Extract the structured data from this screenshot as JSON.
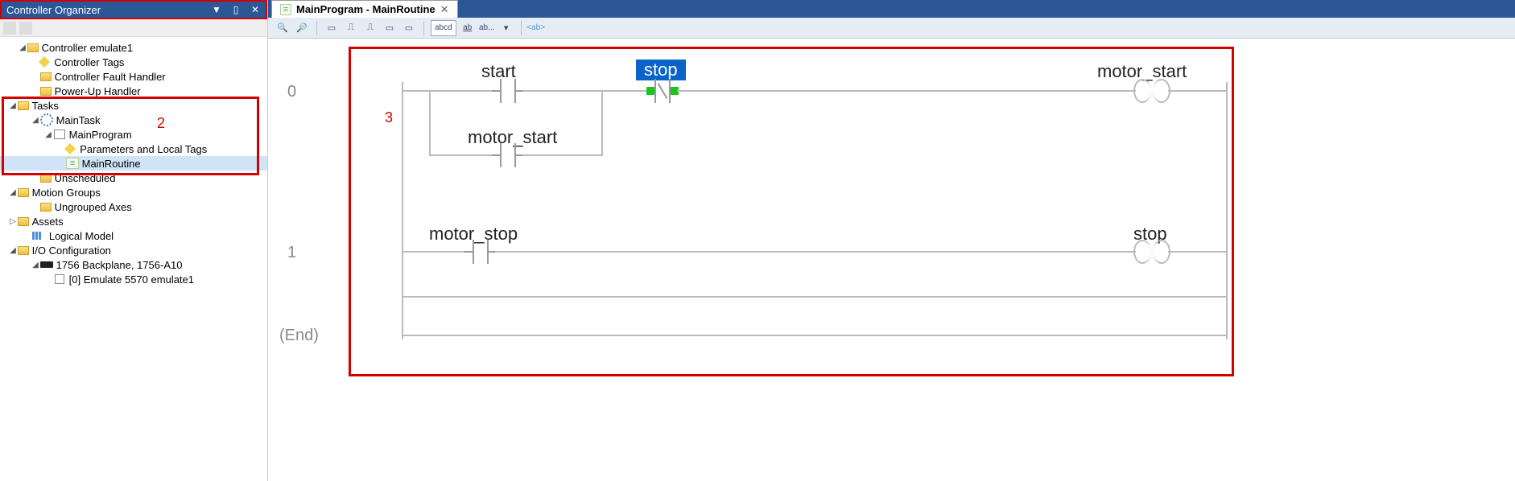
{
  "panel": {
    "title": "Controller Organizer"
  },
  "tree": {
    "controller_root": "Controller emulate1",
    "controller_tags": "Controller Tags",
    "fault_handler": "Controller Fault Handler",
    "power_up_handler": "Power-Up Handler",
    "tasks": "Tasks",
    "main_task": "MainTask",
    "main_program": "MainProgram",
    "params_local_tags": "Parameters and Local Tags",
    "main_routine": "MainRoutine",
    "unscheduled": "Unscheduled",
    "motion_groups": "Motion Groups",
    "ungrouped_axes": "Ungrouped Axes",
    "assets": "Assets",
    "logical_model": "Logical Model",
    "io_config": "I/O Configuration",
    "backplane": "1756 Backplane, 1756-A10",
    "slot0": "[0] Emulate 5570 emulate1"
  },
  "annotations": {
    "tasks_box_num": "2",
    "ladder_box_num": "3"
  },
  "tab": {
    "title": "MainProgram - MainRoutine"
  },
  "toolbar": {
    "abcd": "abcd",
    "ab_frac": "ab",
    "ab_ellipsis": "ab...",
    "ab_brackets": "<ab>"
  },
  "ladder": {
    "rung0": {
      "num": "0",
      "contact_start": "start",
      "contact_motor_start": "motor_start",
      "contact_stop": "stop",
      "coil_motor_start": "motor_start"
    },
    "rung1": {
      "num": "1",
      "contact_motor_stop": "motor_stop",
      "coil_stop": "stop"
    },
    "end_label": "(End)"
  }
}
